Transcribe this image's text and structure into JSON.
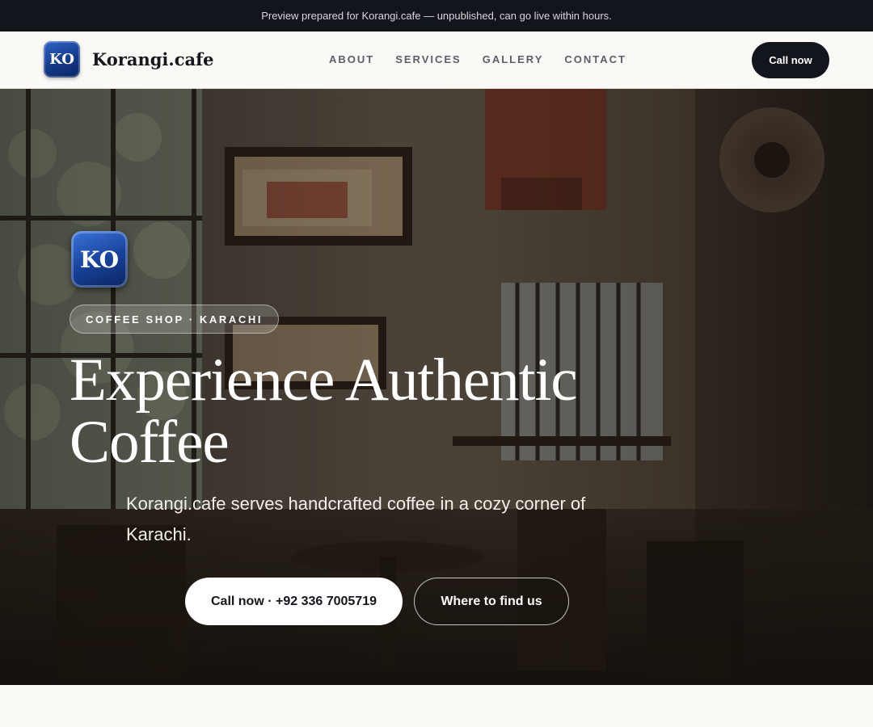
{
  "announcement": {
    "text": "Preview prepared for Korangi.cafe — unpublished, can go live within hours."
  },
  "header": {
    "logo_text": "KO",
    "brand_name": "Korangi.cafe",
    "nav": [
      {
        "label": "ABOUT"
      },
      {
        "label": "SERVICES"
      },
      {
        "label": "GALLERY"
      },
      {
        "label": "CONTACT"
      }
    ],
    "cta_label": "Call now"
  },
  "hero": {
    "logo_text": "KO",
    "badge": "COFFEE SHOP · KARACHI",
    "headline": "Experience Authentic Coffee",
    "subheadline": "Korangi.cafe serves handcrafted coffee in a cozy corner of Karachi.",
    "primary_button": "Call now · +92 336 7005719",
    "secondary_button": "Where to find us"
  },
  "colors": {
    "dark": "#12151b",
    "page_background": "#faf9f6",
    "logo_blue": "#174096"
  }
}
